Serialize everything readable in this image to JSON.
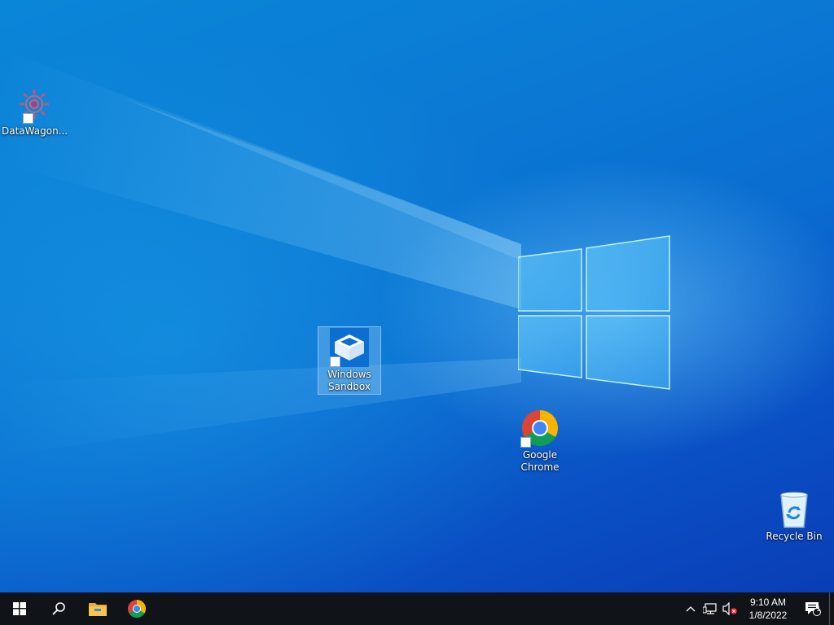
{
  "desktop": {
    "icons": [
      {
        "label": "DataWagon...",
        "icon": "datawagon-gear-icon"
      },
      {
        "label": "Windows\nSandbox",
        "line1": "Windows",
        "line2": "Sandbox",
        "icon": "windows-sandbox-icon",
        "selected": true
      },
      {
        "label": "Google Chrome",
        "line1": "Google",
        "line2": "Chrome",
        "icon": "chrome-icon"
      },
      {
        "label": "Recycle Bin",
        "icon": "recycle-bin-icon"
      }
    ]
  },
  "taskbar": {
    "start": "windows-start-icon",
    "search": "search-icon",
    "pinned": [
      "file-explorer-icon",
      "chrome-icon"
    ],
    "tray": {
      "icons": [
        "chevron-up-icon",
        "network-icon",
        "volume-muted-icon"
      ],
      "time": "9:10 AM",
      "date": "1/8/2022",
      "notification_count": "1"
    }
  },
  "colors": {
    "taskbar": "#101418",
    "accent": "#0a78d7"
  }
}
